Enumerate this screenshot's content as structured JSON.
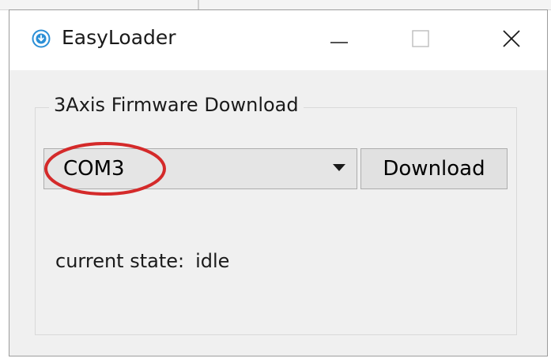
{
  "window": {
    "title": "EasyLoader",
    "icon": "download-circle-icon",
    "accent_color": "#2b8fd6"
  },
  "caption_buttons": {
    "minimize": "minimize-icon",
    "maximize": "maximize-icon",
    "close": "close-icon"
  },
  "group": {
    "title": "3Axis Firmware Download"
  },
  "port_select": {
    "selected": "COM3",
    "annotation_color": "#d42a2a"
  },
  "download_button": {
    "label": "Download"
  },
  "status": {
    "label": "current state:",
    "value": "idle"
  }
}
